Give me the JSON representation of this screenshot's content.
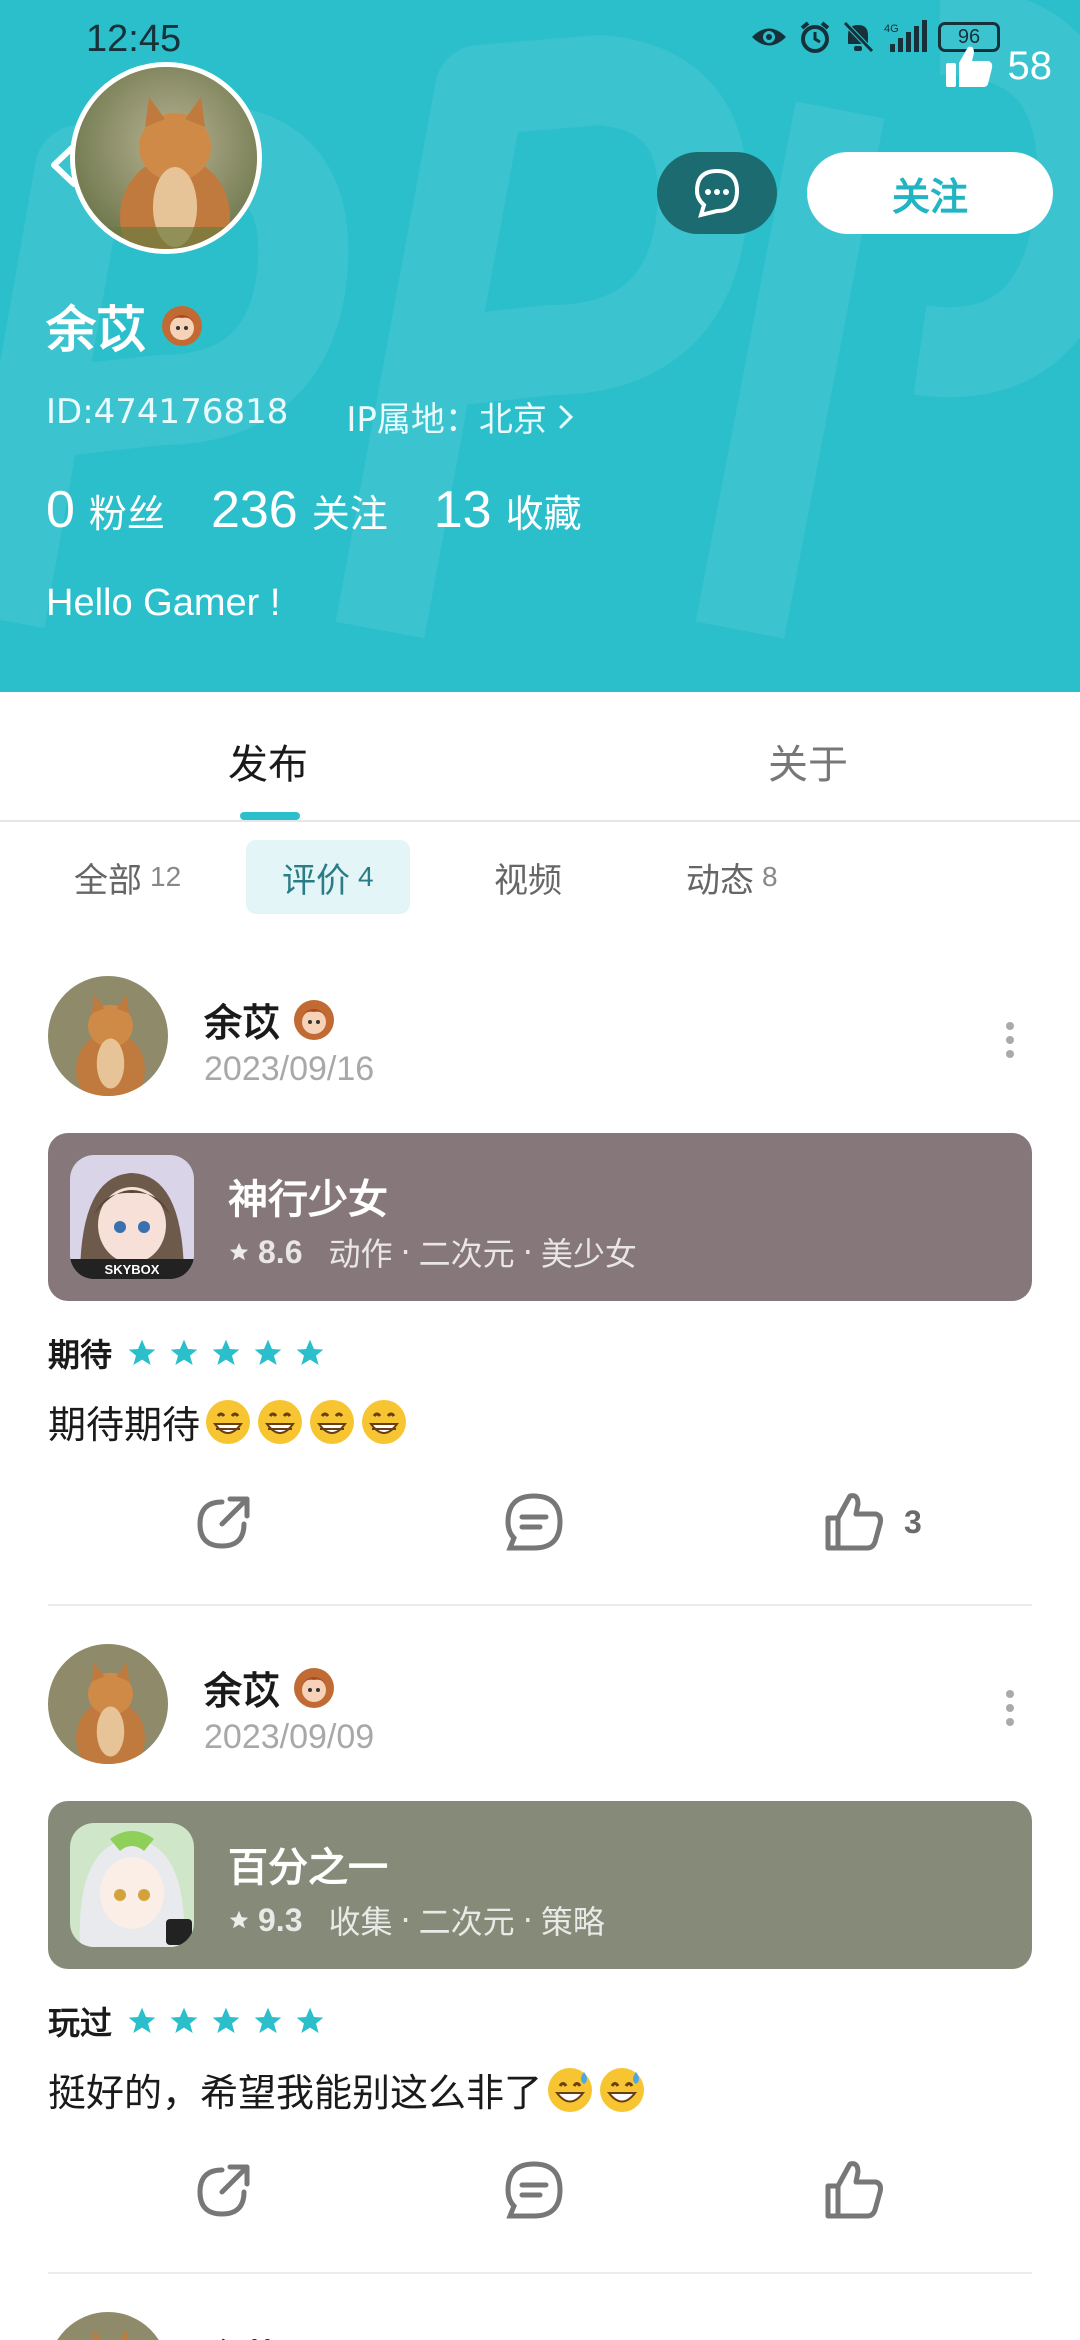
{
  "status_bar": {
    "time": "12:45",
    "battery": "96",
    "network": "4G"
  },
  "profile": {
    "likes": "58",
    "follow_label": "关注",
    "name": "余苡",
    "id_text": "ID:474176818",
    "ip_text": "IP属地：北京",
    "stats": [
      {
        "num": "0",
        "label": "粉丝"
      },
      {
        "num": "236",
        "label": "关注"
      },
      {
        "num": "13",
        "label": "收藏"
      }
    ],
    "bio": "Hello Gamer !"
  },
  "tabs": {
    "publish": "发布",
    "about": "关于"
  },
  "filters": [
    {
      "label": "全部",
      "count": "12"
    },
    {
      "label": "评价",
      "count": "4"
    },
    {
      "label": "视频",
      "count": ""
    },
    {
      "label": "动态",
      "count": "8"
    }
  ],
  "posts": [
    {
      "author": "余苡",
      "date": "2023/09/16",
      "game": {
        "title": "神行少女",
        "score": "8.6",
        "tags": [
          "动作",
          "二次元",
          "美少女"
        ],
        "card_color": "#85777a",
        "icon_label": "SKYBOX"
      },
      "rating_label": "期待",
      "stars": 5,
      "text": "期待期待",
      "emojis": [
        "grin",
        "grin",
        "grin",
        "grin"
      ],
      "like_count": "3"
    },
    {
      "author": "余苡",
      "date": "2023/09/09",
      "game": {
        "title": "百分之一",
        "score": "9.3",
        "tags": [
          "收集",
          "二次元",
          "策略"
        ],
        "card_color": "#868a78",
        "icon_label": ""
      },
      "rating_label": "玩过",
      "stars": 5,
      "text": "挺好的，希望我能别这么非了",
      "emojis": [
        "sweat-smile",
        "sweat-smile"
      ],
      "like_count": ""
    },
    {
      "author": "余苡"
    }
  ],
  "colors": {
    "accent": "#2bbfcc",
    "star": "#2bbfcc"
  }
}
